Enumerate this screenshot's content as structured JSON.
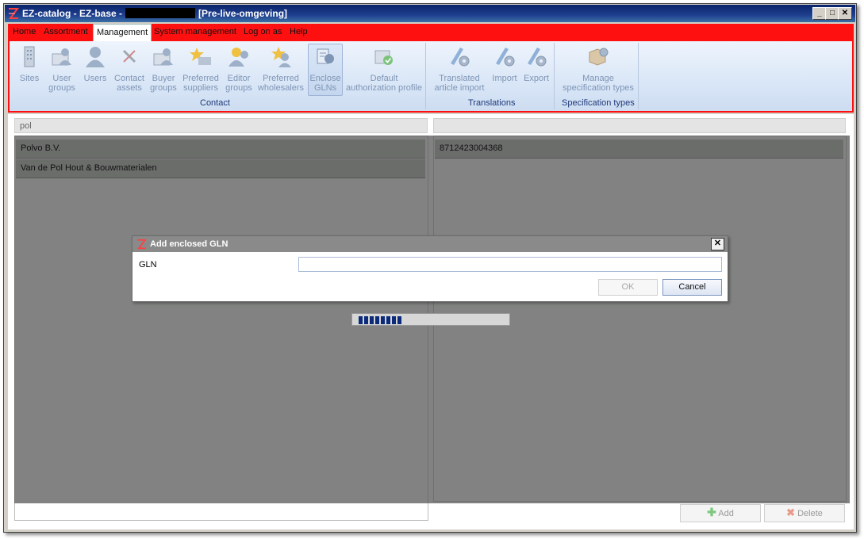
{
  "window": {
    "title_prefix": "EZ-catalog - EZ-base -",
    "title_suffix": "[Pre-live-omgeving]"
  },
  "menu": {
    "items": [
      {
        "label": "Home"
      },
      {
        "label": "Assortment"
      },
      {
        "label": "Management",
        "active": true
      },
      {
        "label": "System management"
      },
      {
        "label": "Log on as"
      },
      {
        "label": "Help"
      }
    ]
  },
  "ribbon": {
    "contact": {
      "label": "Contact",
      "buttons": [
        {
          "line1": "Sites",
          "line2": "",
          "icon": "building-icon"
        },
        {
          "line1": "User",
          "line2": "groups",
          "icon": "users-folder-icon"
        },
        {
          "line1": "Users",
          "line2": "",
          "icon": "user-icon"
        },
        {
          "line1": "Contact",
          "line2": "assets",
          "icon": "tools-icon"
        },
        {
          "line1": "Buyer",
          "line2": "groups",
          "icon": "buyer-group-icon"
        },
        {
          "line1": "Preferred",
          "line2": "suppliers",
          "icon": "supplier-star-icon"
        },
        {
          "line1": "Editor",
          "line2": "groups",
          "icon": "editor-group-icon"
        },
        {
          "line1": "Preferred",
          "line2": "wholesalers",
          "icon": "wholesaler-star-icon"
        },
        {
          "line1": "Enclose",
          "line2": "GLNs",
          "icon": "gln-icon",
          "selected": true
        },
        {
          "line1": "Default",
          "line2": "authorization profile",
          "icon": "authorization-icon"
        }
      ]
    },
    "translations": {
      "label": "Translations",
      "buttons": [
        {
          "line1": "Translated",
          "line2": "article import",
          "icon": "translate-gear-icon"
        },
        {
          "line1": "Import",
          "line2": "",
          "icon": "import-gear-icon"
        },
        {
          "line1": "Export",
          "line2": "",
          "icon": "export-gear-icon"
        }
      ]
    },
    "specification": {
      "label": "Specification types",
      "buttons": [
        {
          "line1": "Manage",
          "line2": "specification types",
          "icon": "box-gear-icon"
        }
      ]
    }
  },
  "left_panel": {
    "filter_value": "pol",
    "rows": [
      "Polvo B.V.",
      "Van de Pol Hout & Bouwmaterialen"
    ]
  },
  "right_panel": {
    "filter_value": "",
    "rows": [
      "8712423004368"
    ],
    "add_label": "Add",
    "delete_label": "Delete"
  },
  "dialog": {
    "title": "Add enclosed GLN",
    "field_label": "GLN",
    "field_value": "",
    "ok_label": "OK",
    "cancel_label": "Cancel",
    "close_glyph": "✕"
  },
  "progress": {
    "indeterminate": true
  },
  "colors": {
    "ribbon_highlight": "#ff1010",
    "title_bar": "#0a246a",
    "overlay": "#505250"
  }
}
